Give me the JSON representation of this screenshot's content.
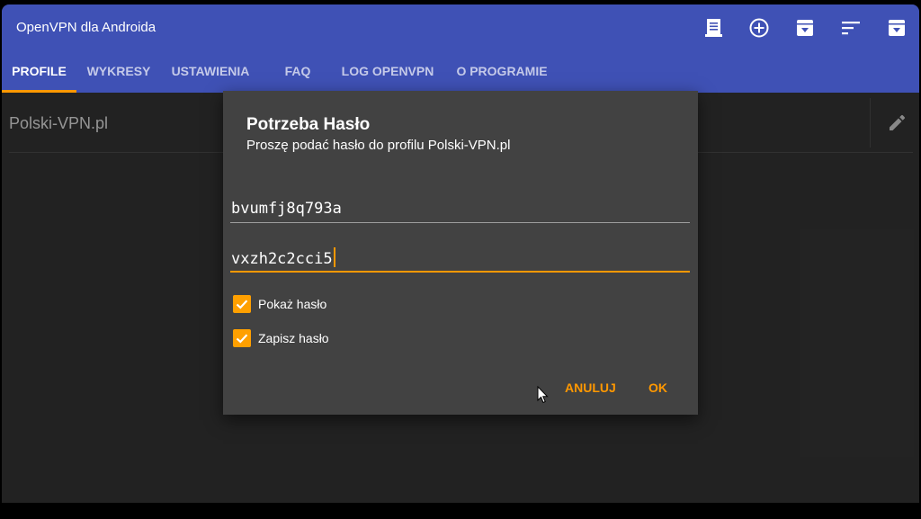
{
  "app": {
    "title": "OpenVPN dla Androida"
  },
  "toolbar": {
    "actions": [
      {
        "name": "import-log-icon"
      },
      {
        "name": "add-icon"
      },
      {
        "name": "import-icon"
      },
      {
        "name": "sort-icon"
      },
      {
        "name": "archive-icon"
      }
    ]
  },
  "tabs": [
    {
      "label": "PROFILE",
      "active": true
    },
    {
      "label": "WYKRESY"
    },
    {
      "label": "USTAWIENIA"
    },
    {
      "label": "FAQ"
    },
    {
      "label": "LOG OPENVPN"
    },
    {
      "label": "O PROGRAMIE"
    }
  ],
  "profile": {
    "name": "Polski-VPN.pl"
  },
  "dialog": {
    "title": "Potrzeba Hasło",
    "message": "Proszę podać hasło do profilu Polski-VPN.pl",
    "username_value": "bvumfj8q793a",
    "password_value": "vxzh2c2cci5",
    "show_password_label": "Pokaż hasło",
    "show_password_checked": true,
    "save_password_label": "Zapisz hasło",
    "save_password_checked": true,
    "cancel_label": "ANULUJ",
    "ok_label": "OK"
  },
  "colors": {
    "app_bar": "#3f51b5",
    "accent": "#ff9800",
    "dialog_bg": "#424242",
    "background": "#303030"
  }
}
